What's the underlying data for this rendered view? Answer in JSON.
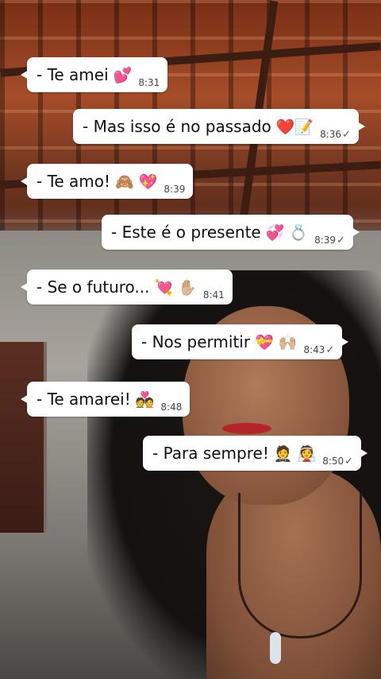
{
  "messages": [
    {
      "text": "- Te amei",
      "emoji": "💕",
      "time": "8:31",
      "dir": "in"
    },
    {
      "text": "- Mas isso é no passado",
      "emoji": "❤️📝",
      "time": "8:36",
      "dir": "out"
    },
    {
      "text": "-  Te amo!",
      "emoji": "🙈 💖",
      "time": "8:39",
      "dir": "in"
    },
    {
      "text": "- Este é o presente",
      "emoji": "💞 💍",
      "time": "8:39",
      "dir": "out"
    },
    {
      "text": "- Se o futuro...",
      "emoji": "💘 ✋🏼",
      "time": "8:41",
      "dir": "in"
    },
    {
      "text": "-  Nos permitir",
      "emoji": "💝 🙌🏼",
      "time": "8:43",
      "dir": "out"
    },
    {
      "text": "- Te amarei!",
      "emoji": "💑",
      "time": "8:48",
      "dir": "in"
    },
    {
      "text": "- Para sempre!",
      "emoji": "🤵 👰",
      "time": "8:50",
      "dir": "out"
    }
  ],
  "read_tick": "✓"
}
